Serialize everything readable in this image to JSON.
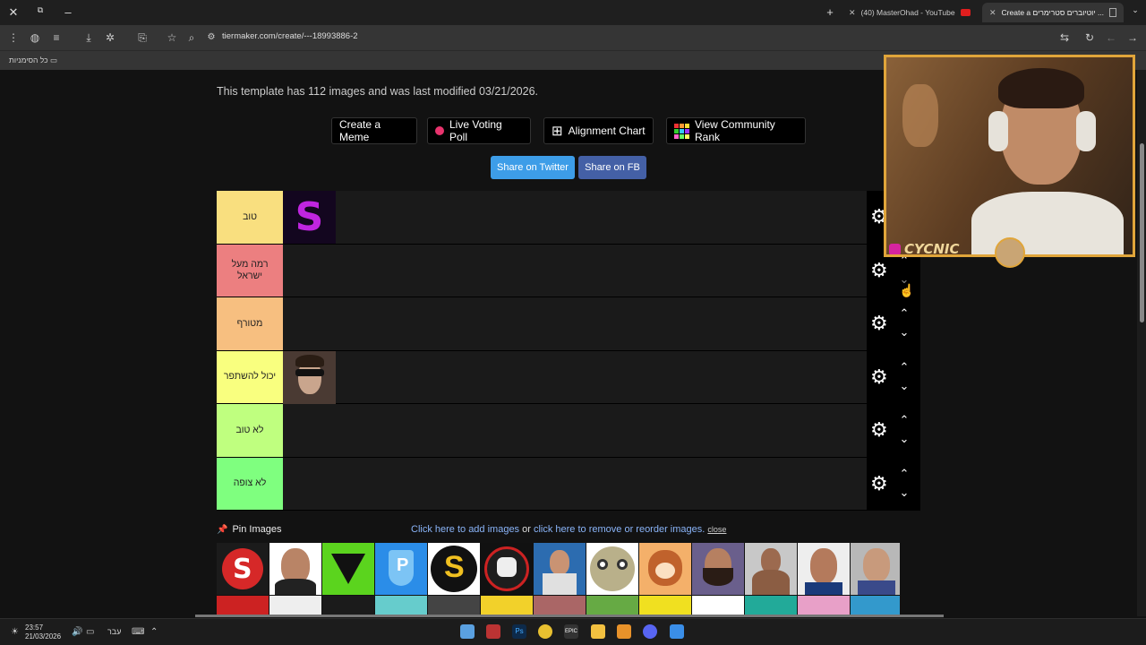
{
  "window": {
    "controls": [
      "✕",
      "⧉",
      "–"
    ]
  },
  "tabs": [
    {
      "label": "(40) MasterOhad - YouTube",
      "active": false
    },
    {
      "label": "Create a יוטיוברים סטרימרים ...",
      "active": true
    }
  ],
  "toolbar": {
    "url": "tiermaker.com/create/---18993886-2"
  },
  "bookmarks": {
    "label": "כל הסימניות"
  },
  "page": {
    "info": "This template has 112 images and was last modified 03/21/2026.",
    "buttons": {
      "meme": "Create a Meme",
      "poll": "Live Voting Poll",
      "alignment": "Alignment Chart",
      "community": "View Community Rank"
    },
    "share": {
      "twitter": "Share on Twitter",
      "fb": "Share on FB"
    },
    "tiers": [
      {
        "label": "טוב",
        "color": "#f9df7f"
      },
      {
        "label": "רמה מעל ישראל",
        "color": "#ec7f80"
      },
      {
        "label": "מטורף",
        "color": "#f7bf80"
      },
      {
        "label": "יכול להשתפר",
        "color": "#f9ff7f"
      },
      {
        "label": "לא טוב",
        "color": "#bfff7f"
      },
      {
        "label": "לא צופה",
        "color": "#7fff7f"
      }
    ],
    "pin": {
      "label": "Pin Images",
      "add_link": "Click here to add images",
      "or": " or ",
      "remove_link": "click here to remove or reorder images.",
      "close": "close"
    }
  },
  "webcam": {
    "name": "CYCNIC"
  },
  "taskbar": {
    "time": "23:57",
    "date": "21/03/2026",
    "lang": "עבר"
  }
}
